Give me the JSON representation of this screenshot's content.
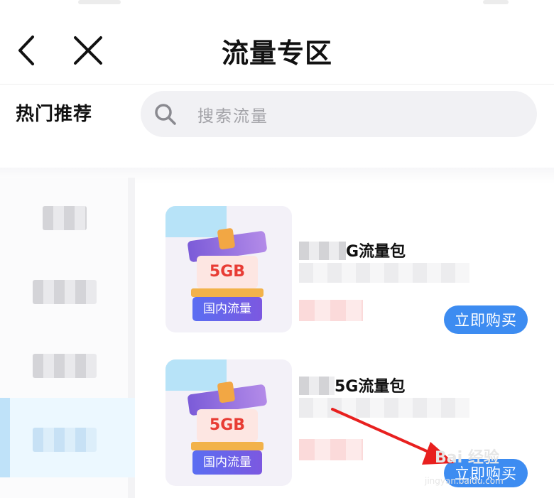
{
  "header": {
    "title": "流量专区"
  },
  "search": {
    "section_label": "热门推荐",
    "placeholder": "搜索流量"
  },
  "products": [
    {
      "name_suffix": "G流量包",
      "volume": "5GB",
      "badge": "国内流量",
      "buy_label": "立即购买"
    },
    {
      "name_suffix": "5G流量包",
      "volume": "5GB",
      "badge": "国内流量",
      "buy_label": "立即购买"
    }
  ],
  "watermark": {
    "brand": "Bai 经验",
    "url": "jingyan.baidu.com"
  },
  "colors": {
    "accent": "#3d8cf1",
    "arrow": "#e8201f",
    "active_tab": "#ecf8ff"
  }
}
